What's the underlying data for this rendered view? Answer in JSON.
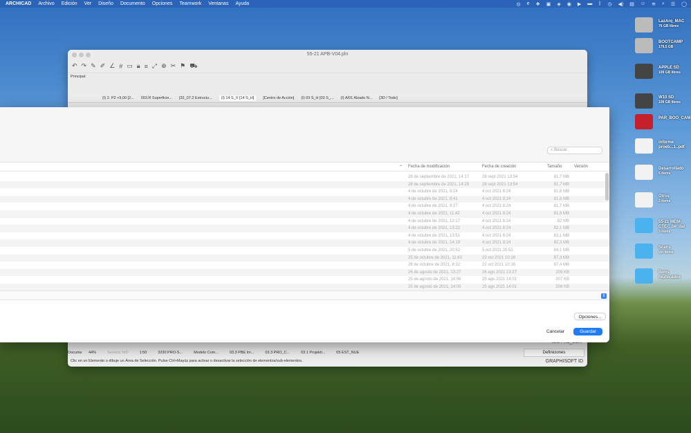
{
  "menubar": {
    "app": "ARCHICAD",
    "items": [
      "Archivo",
      "Edición",
      "Ver",
      "Diseño",
      "Documento",
      "Opciones",
      "Teamwork",
      "Ventanas",
      "Ayuda"
    ]
  },
  "archicad": {
    "title": "55-21 APB-V04.pln",
    "toolbar_label": "Principal:",
    "tabs": [
      "(I) 2. P2 +9,00 [2...",
      "003.R Superficie...",
      "[32_07.2 Estructu...",
      "(I) 14 S_V [14 S_H]",
      "[Centro de Acción]",
      "(I) 03 S_H [03 S_...",
      "(I) A/01 Alzado N...",
      "[3D / Todo]"
    ],
    "status": {
      "zoom": "44%",
      "service": "Servicio N/D",
      "scale": "1:50",
      "items": [
        "3230 PRO-S...",
        "Modelo Com...",
        "03.3 PBE Im...",
        "03.3 PRO_C...",
        "03.1 Projekti...",
        "05 EST_NUE"
      ],
      "hint": "Clic en un Elemento o dibuje un Área de Selección. Pulse Ctrl+Mayús para activar o desactivar la selección de elementos/sub-elementos.",
      "pro_com": "03.3 PRO_COM",
      "definiciones": "Definiciones",
      "brand": "GRAPHISOFT ID",
      "left_label": "Docume"
    }
  },
  "dialog": {
    "search_placeholder": "Buscar",
    "columns": [
      "Fecha de modificación",
      "Fecha de creación",
      "Tamaño",
      "Versión"
    ],
    "rows": [
      [
        "28 de septiembre de 2021, 14:17",
        "28 sept 2021 13:54",
        "81,7 MB"
      ],
      [
        "28 de septiembre de 2021, 14:28",
        "28 sept 2021 13:54",
        "81,7 MB"
      ],
      [
        "4 de octubre de 2021, 8:24",
        "4 oct 2021 8:24",
        "81,6 MB"
      ],
      [
        "4 de octubre de 2021, 8:41",
        "4 oct 2021 8:24",
        "81,6 MB"
      ],
      [
        "4 de octubre de 2021, 9:27",
        "4 oct 2021 8:24",
        "81,7 MB"
      ],
      [
        "4 de octubre de 2021, 11:42",
        "4 oct 2021 8:24",
        "81,9 MB"
      ],
      [
        "4 de octubre de 2021, 12:17",
        "4 oct 2021 8:24",
        "82 MB"
      ],
      [
        "4 de octubre de 2021, 13:22",
        "4 oct 2021 8:24",
        "82,1 MB"
      ],
      [
        "4 de octubre de 2021, 13:51",
        "4 oct 2021 8:24",
        "82,1 MB"
      ],
      [
        "4 de octubre de 2021, 14:19",
        "4 oct 2021 8:24",
        "82,3 MB"
      ],
      [
        "5 de octubre de 2021, 20:52",
        "5 oct 2021 20:52",
        "84,1 MB"
      ],
      [
        "25 de octubre de 2021, 11:43",
        "22 oct 2021 10:16",
        "87,3 MB"
      ],
      [
        "28 de octubre de 2021, 8:32",
        "22 oct 2021 10:16",
        "87,4 MB"
      ],
      [
        "26 de agosto de 2021, 13:27",
        "26 ago 2021 13:27",
        "209 KB"
      ],
      [
        "25 de agosto de 2021, 14:06",
        "25 ago 2021 14:01",
        "207 KB"
      ],
      [
        "25 de agosto de 2021, 14:09",
        "25 ago 2021 14:01",
        "208 KB"
      ]
    ],
    "options": "Opciones...",
    "cancel": "Cancelar",
    "save": "Guardar"
  },
  "desktop": [
    {
      "name": "LazArq_MAC",
      "sub": "76 GB libres",
      "color": "#bbbbbb"
    },
    {
      "name": "BOOTCAMP",
      "sub": "179,5 GB",
      "color": "#bbbbbb"
    },
    {
      "name": "APPLE SD",
      "sub": "109 GB libres",
      "color": "#444"
    },
    {
      "name": "W10 SD",
      "sub": "109 GB libres",
      "color": "#444"
    },
    {
      "name": "PAR_BOO_CAM",
      "sub": "",
      "color": "#c4202a"
    },
    {
      "name": "informe proeb...1..pdf",
      "sub": "",
      "color": "#f2f2f2"
    },
    {
      "name": "Desarrollado",
      "sub": "5 ítems",
      "color": "#f2f2f2"
    },
    {
      "name": "Otros",
      "sub": "2 ítems",
      "color": "#f2f2f2"
    },
    {
      "name": "55-21 MEM-CTE-...be_dal",
      "sub": "3 ítems",
      "color": "#4ab3ef"
    },
    {
      "name": "Scans",
      "sub": "sin ítems",
      "color": "#4ab3ef"
    },
    {
      "name": "Ítems reubicados",
      "sub": "",
      "color": "#4ab3ef"
    }
  ]
}
